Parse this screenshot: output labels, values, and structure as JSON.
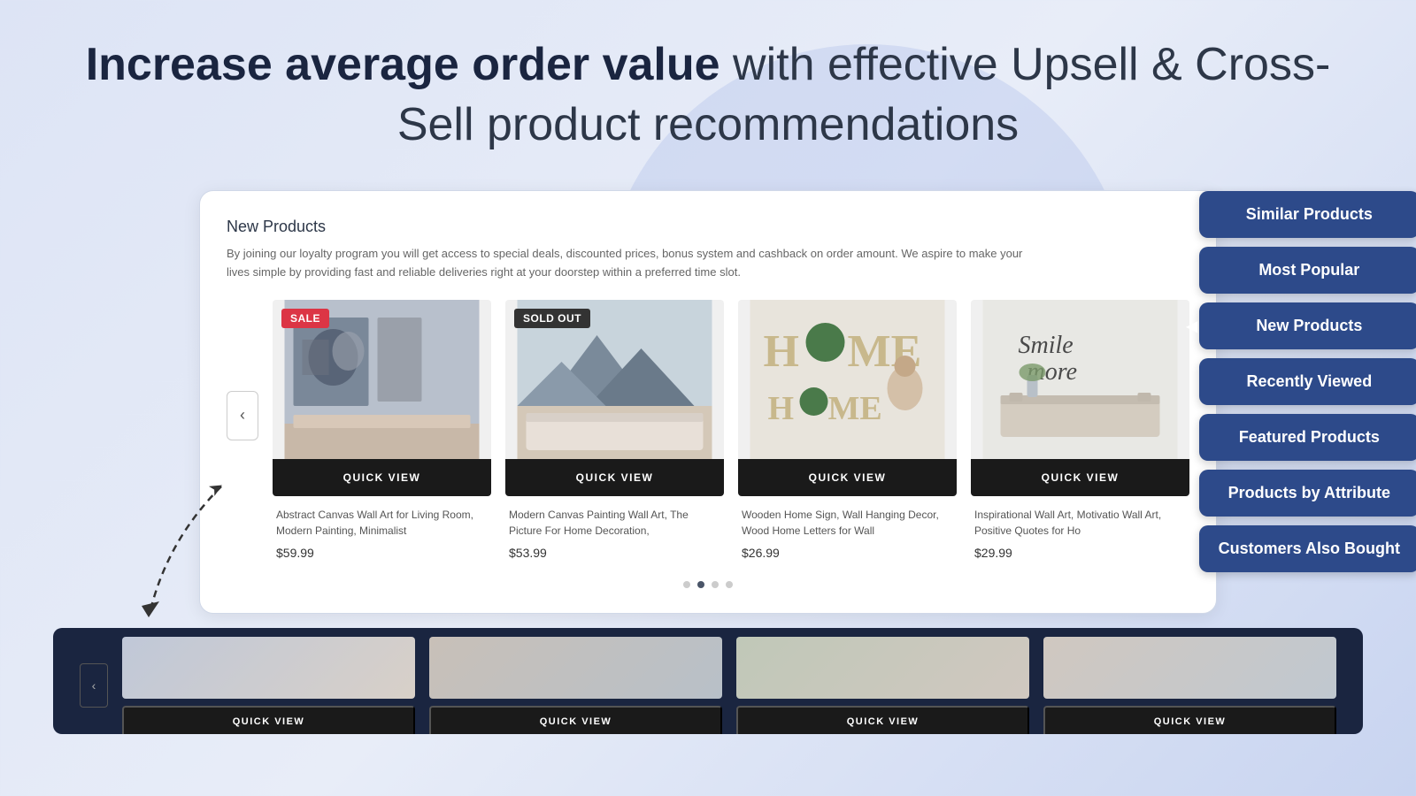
{
  "headline": {
    "bold_part": "Increase average order value",
    "normal_part": " with effective Upsell & Cross-Sell product recommendations"
  },
  "card": {
    "section_title": "New Products",
    "description": "By joining our loyalty program you will get access to special deals, discounted prices, bonus system and cashback on order amount. We aspire to make your lives simple by providing fast and reliable deliveries right at your doorstep within a preferred time slot."
  },
  "products": [
    {
      "badge": "SALE",
      "badge_type": "sale",
      "name": "Abstract Canvas Wall Art for Living Room, Modern Painting, Minimalist",
      "price": "$59.99",
      "quick_view_label": "QUICK VIEW"
    },
    {
      "badge": "SOLD OUT",
      "badge_type": "soldout",
      "name": "Modern Canvas Painting Wall Art, The Picture For Home Decoration,",
      "price": "$53.99",
      "quick_view_label": "QUICK VIEW"
    },
    {
      "badge": null,
      "badge_type": null,
      "name": "Wooden Home Sign, Wall Hanging Decor, Wood Home Letters for Wall",
      "price": "$26.99",
      "quick_view_label": "QUICK VIEW"
    },
    {
      "badge": null,
      "badge_type": null,
      "name": "Inspirational Wall Art, Motivatio Wall Art, Positive Quotes for Ho",
      "price": "$29.99",
      "quick_view_label": "QUICK VIEW"
    }
  ],
  "dots": [
    {
      "active": false
    },
    {
      "active": true
    },
    {
      "active": false
    },
    {
      "active": false
    }
  ],
  "floating_buttons": [
    {
      "label": "Similar Products",
      "active": false,
      "has_arrow": false
    },
    {
      "label": "Most Popular",
      "active": false,
      "has_arrow": false
    },
    {
      "label": "New Products",
      "active": false,
      "has_arrow": true
    },
    {
      "label": "Recently Viewed",
      "active": false,
      "has_arrow": false
    },
    {
      "label": "Featured Products",
      "active": false,
      "has_arrow": false
    },
    {
      "label": "Products by Attribute",
      "active": false,
      "has_arrow": false
    },
    {
      "label": "Customers Also Bought",
      "active": false,
      "has_arrow": false
    }
  ],
  "bottom_products": [
    {
      "quick_view": "QUICK VIEW"
    },
    {
      "quick_view": "QUICK VIEW"
    },
    {
      "quick_view": "QUICK VIEW"
    },
    {
      "quick_view": "QUICK VIEW"
    }
  ],
  "nav_arrow": "‹",
  "bottom_nav_arrow": "‹"
}
